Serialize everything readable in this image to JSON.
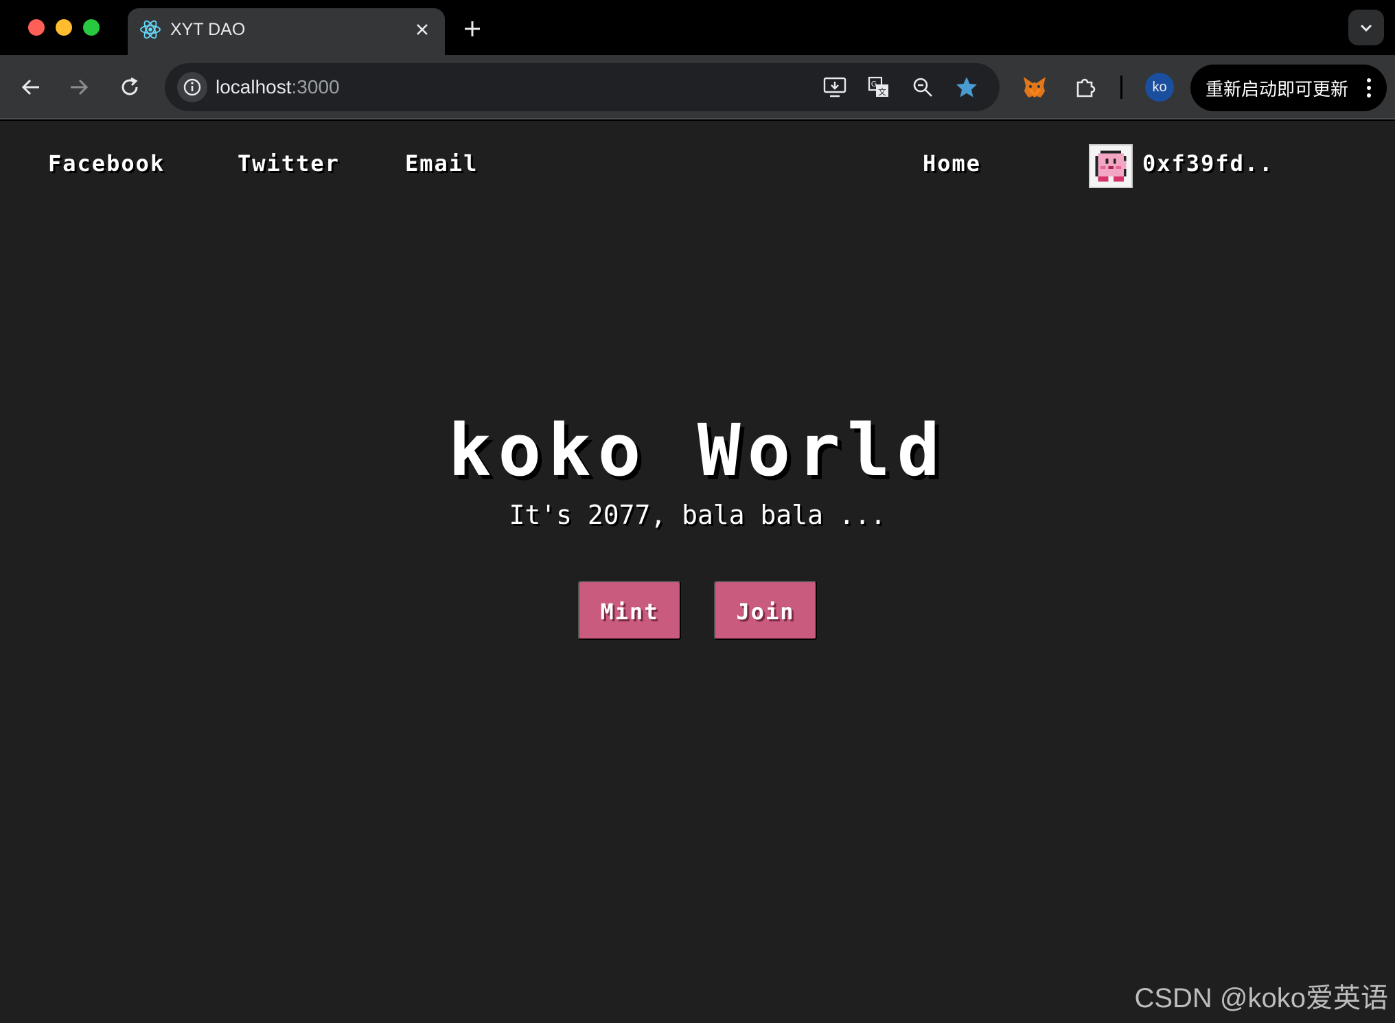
{
  "browser": {
    "tab": {
      "title": "XYT DAO",
      "favicon": "react-icon"
    },
    "address": {
      "host": "localhost",
      "port": ":3000"
    },
    "profile_initials": "ko",
    "update_label": "重新启动即可更新"
  },
  "page": {
    "nav_left": [
      "Facebook",
      "Twitter",
      "Email"
    ],
    "nav_home": "Home",
    "wallet_address": "0xf39fd..",
    "avatar": "kirby-avatar",
    "hero": {
      "title": "koko World",
      "subtitle": "It's 2077, bala bala ...",
      "buttons": [
        "Mint",
        "Join"
      ]
    },
    "accent_color": "#c85b7e",
    "background_color": "#1f1f20"
  },
  "watermark": "CSDN @koko爱英语"
}
